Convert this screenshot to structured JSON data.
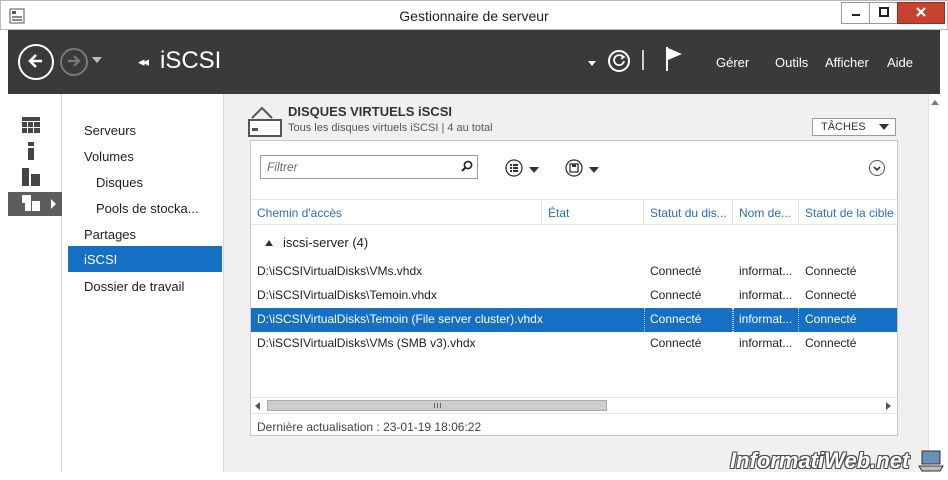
{
  "window": {
    "title": "Gestionnaire de serveur"
  },
  "header": {
    "page_title": "iSCSI",
    "crumb_arrows": "◂◂",
    "menu": [
      "Gérer",
      "Outils",
      "Afficher",
      "Aide"
    ]
  },
  "nav": {
    "items": [
      {
        "label": "Serveurs",
        "level": 0
      },
      {
        "label": "Volumes",
        "level": 0
      },
      {
        "label": "Disques",
        "level": 1
      },
      {
        "label": "Pools de stocka...",
        "level": 1
      },
      {
        "label": "Partages",
        "level": 0
      },
      {
        "label": "iSCSI",
        "level": 0,
        "selected": true
      },
      {
        "label": "Dossier de travail",
        "level": 0
      }
    ]
  },
  "section": {
    "title": "DISQUES VIRTUELS iSCSI",
    "subtitle": "Tous les disques virtuels iSCSI | 4 au total",
    "tasks_label": "TÂCHES"
  },
  "filter": {
    "placeholder": "Filtrer"
  },
  "table": {
    "columns": [
      "Chemin d'accès",
      "État",
      "Statut du dis...",
      "Nom de...",
      "Statut de la cible"
    ],
    "group_label": "iscsi-server (4)",
    "rows": [
      {
        "path": "D:\\iSCSIVirtualDisks\\VMs.vhdx",
        "state": "",
        "disk_status": "Connecté",
        "name": "informat...",
        "target_status": "Connecté",
        "selected": false
      },
      {
        "path": "D:\\iSCSIVirtualDisks\\Temoin.vhdx",
        "state": "",
        "disk_status": "Connecté",
        "name": "informat...",
        "target_status": "Connecté",
        "selected": false
      },
      {
        "path": "D:\\iSCSIVirtualDisks\\Temoin (File server cluster).vhdx",
        "state": "",
        "disk_status": "Connecté",
        "name": "informat...",
        "target_status": "Connecté",
        "selected": true
      },
      {
        "path": "D:\\iSCSIVirtualDisks\\VMs (SMB v3).vhdx",
        "state": "",
        "disk_status": "Connecté",
        "name": "informat...",
        "target_status": "Connecté",
        "selected": false
      }
    ]
  },
  "status_bar": {
    "text": "Dernière actualisation : 23-01-19 18:06:22"
  },
  "watermark": {
    "text": "InformatiWeb.net"
  },
  "colors": {
    "header_bg": "#3a3a3a",
    "selection": "#1570c4",
    "column_header_text": "#2a6ebd",
    "close_button": "#c7432f"
  }
}
